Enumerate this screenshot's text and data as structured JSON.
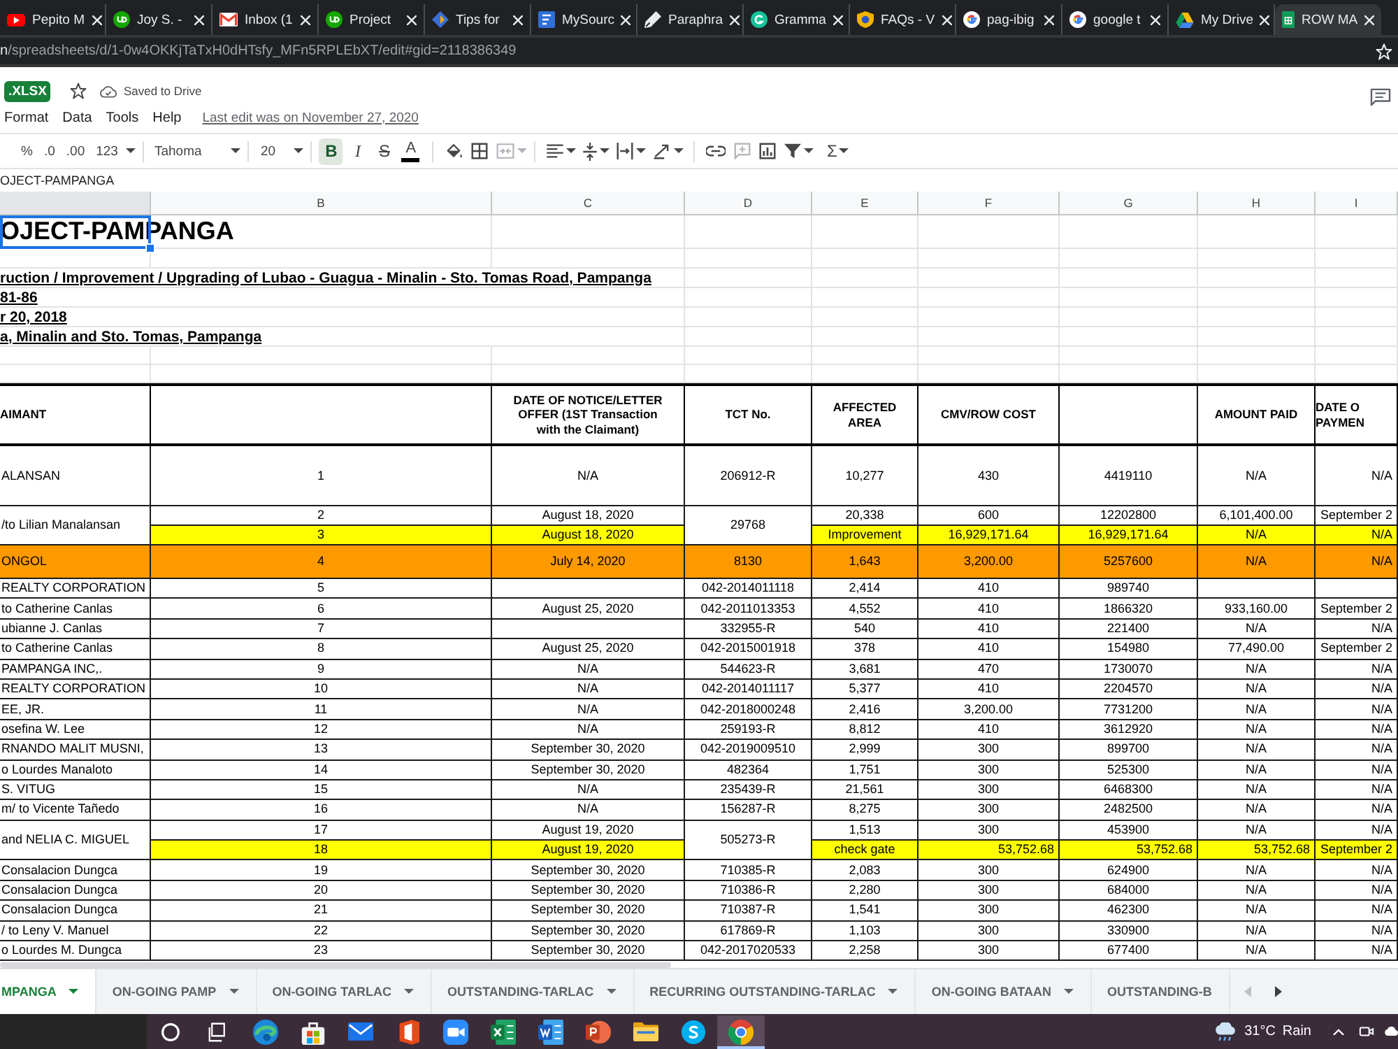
{
  "browser": {
    "tabs": [
      {
        "title": "Pepito M",
        "kind": "play",
        "selected": false
      },
      {
        "title": "Joy S. -",
        "kind": "badge",
        "selected": false
      },
      {
        "title": "Inbox (1",
        "kind": "mail",
        "selected": false
      },
      {
        "title": "Project",
        "kind": "badge",
        "selected": false
      },
      {
        "title": "Tips for",
        "kind": "diamond",
        "selected": false
      },
      {
        "title": "MySourc",
        "kind": "page",
        "selected": false
      },
      {
        "title": "Paraphra",
        "kind": "pen",
        "selected": false
      },
      {
        "title": "Gramma",
        "kind": "ring",
        "selected": false
      },
      {
        "title": "FAQs - V",
        "kind": "shield",
        "selected": false
      },
      {
        "title": "pag-ibig",
        "kind": "google",
        "selected": false
      },
      {
        "title": "google t",
        "kind": "google",
        "selected": false
      },
      {
        "title": "My Drive",
        "kind": "drive",
        "selected": false
      },
      {
        "title": "ROW MA",
        "kind": "sheet",
        "selected": true
      }
    ],
    "address": {
      "host": "n",
      "path": "/spreadsheets/d/1-0w4OKKjTaTxH0dHTsfy_MFn5RPLEbXT/edit#gid=2118386349"
    }
  },
  "document": {
    "file_type": ".XLSX",
    "save_status": "Saved to Drive",
    "menu": [
      "Format",
      "Data",
      "Tools",
      "Help"
    ],
    "last_edit": "Last edit was on November 27, 2020"
  },
  "toolbar": {
    "number_formats": [
      "%",
      ".0",
      ".00",
      "123"
    ],
    "font": "Tahoma",
    "font_size": "20",
    "format_buttons": [
      {
        "label": "B",
        "kind": "bold",
        "selected": true
      },
      {
        "label": "I",
        "kind": "italic",
        "selected": false
      },
      {
        "label": "S",
        "kind": "strike",
        "selected": false
      },
      {
        "label": "A",
        "kind": "color",
        "selected": false
      }
    ],
    "functions": "Σ"
  },
  "formula_bar": {
    "value": "OJECT-PAMPANGA"
  },
  "sheet": {
    "column_letters": [
      "B",
      "C",
      "D",
      "E",
      "F",
      "G",
      "H",
      "I"
    ],
    "title": "OJECT-PAMPANGA",
    "info_lines": [
      "ruction / Improvement / Upgrading of Lubao - Guagua - Minalin - Sto. Tomas Road, Pampanga",
      "81-86",
      "r 20, 2018",
      "a, Minalin and Sto. Tomas, Pampanga"
    ],
    "table": {
      "columns": [
        {
          "label": "AIMANT"
        },
        {},
        {
          "label": "DATE OF NOTICE/LETTER OFFER (1ST Transaction with the Claimant)"
        },
        {
          "label": "TCT No."
        },
        {
          "label": "AFFECTED AREA"
        },
        {
          "label": "CMV/ROW COST"
        },
        {},
        {
          "label": "AMOUNT PAID"
        },
        {
          "label": "DATE O PAYMEN"
        }
      ],
      "entries": [
        {
          "column_1": "ALANSAN",
          "tct_no": "206912-R",
          "lines": [
            {
              "kind": "standard",
              "column_2": "1",
              "notice_date": "N/A",
              "affected_area": "10,277",
              "cmv_row_cost": "430",
              "column_7": "4419110",
              "amount_paid": "N/A",
              "column_9": "N/A"
            }
          ]
        },
        {
          "column_1": "/to Lilian Manalansan",
          "tct_no": "29768",
          "lines": [
            {
              "kind": "standard",
              "column_2": "2",
              "notice_date": "August 18, 2020",
              "affected_area": "20,338",
              "cmv_row_cost": "600",
              "column_7": "12202800",
              "amount_paid": "6,101,400.00",
              "column_9": "September 2"
            },
            {
              "kind": "standard",
              "color": "#ffff00",
              "column_2": "3",
              "notice_date": "August 18, 2020",
              "affected_area": "Improvement",
              "cmv_row_cost": "16,929,171.64",
              "column_7": "16,929,171.64",
              "amount_paid": "N/A",
              "column_9": "N/A"
            }
          ]
        },
        {
          "column_1": "ONGOL",
          "tct_no": "8130",
          "color": "#ff9900",
          "lines": [
            {
              "kind": "standard",
              "column_2": "4",
              "notice_date": "July 14, 2020",
              "affected_area": "1,643",
              "cmv_row_cost": "3,200.00",
              "column_7": "5257600",
              "amount_paid": "N/A",
              "column_9": "N/A"
            }
          ]
        },
        {
          "column_1": "REALTY CORPORATION",
          "tct_no": "042-2014011118",
          "lines": [
            {
              "kind": "standard",
              "column_2": "5",
              "affected_area": "2,414",
              "cmv_row_cost": "410",
              "column_7": "989740"
            }
          ]
        },
        {
          "column_1": "to Catherine Canlas",
          "tct_no": "042-2011013353",
          "lines": [
            {
              "kind": "standard",
              "column_2": "6",
              "notice_date": "August 25, 2020",
              "affected_area": "4,552",
              "cmv_row_cost": "410",
              "column_7": "1866320",
              "amount_paid": "933,160.00",
              "column_9": "September 2"
            }
          ]
        },
        {
          "column_1": "ubianne J. Canlas",
          "tct_no": "332955-R",
          "lines": [
            {
              "kind": "standard",
              "column_2": "7",
              "affected_area": "540",
              "cmv_row_cost": "410",
              "column_7": "221400",
              "amount_paid": "N/A",
              "column_9": "N/A"
            }
          ]
        },
        {
          "column_1": "to Catherine Canlas",
          "tct_no": "042-2015001918",
          "lines": [
            {
              "kind": "standard",
              "column_2": "8",
              "notice_date": "August 25, 2020",
              "affected_area": "378",
              "cmv_row_cost": "410",
              "column_7": "154980",
              "amount_paid": "77,490.00",
              "column_9": "September 2"
            }
          ]
        },
        {
          "column_1": "PAMPANGA INC,.",
          "tct_no": "544623-R",
          "lines": [
            {
              "kind": "standard",
              "column_2": "9",
              "notice_date": "N/A",
              "affected_area": "3,681",
              "cmv_row_cost": "470",
              "column_7": "1730070",
              "amount_paid": "N/A",
              "column_9": "N/A"
            }
          ]
        },
        {
          "column_1": "REALTY CORPORATION",
          "tct_no": "042-2014011117",
          "lines": [
            {
              "kind": "standard",
              "column_2": "10",
              "notice_date": "N/A",
              "affected_area": "5,377",
              "cmv_row_cost": "410",
              "column_7": "2204570",
              "amount_paid": "N/A",
              "column_9": "N/A"
            }
          ]
        },
        {
          "column_1": "EE, JR.",
          "tct_no": "042-2018000248",
          "lines": [
            {
              "kind": "standard",
              "column_2": "11",
              "notice_date": "N/A",
              "affected_area": "2,416",
              "cmv_row_cost": "3,200.00",
              "column_7": "7731200",
              "amount_paid": "N/A",
              "column_9": "N/A"
            }
          ]
        },
        {
          "column_1": "osefina W. Lee",
          "tct_no": "259193-R",
          "lines": [
            {
              "kind": "standard",
              "column_2": "12",
              "notice_date": "N/A",
              "affected_area": "8,812",
              "cmv_row_cost": "410",
              "column_7": "3612920",
              "amount_paid": "N/A",
              "column_9": "N/A"
            }
          ]
        },
        {
          "column_1": "RNANDO MALIT MUSNI,",
          "tct_no": "042-2019009510",
          "lines": [
            {
              "kind": "standard",
              "column_2": "13",
              "notice_date": "September 30, 2020",
              "affected_area": "2,999",
              "cmv_row_cost": "300",
              "column_7": "899700",
              "amount_paid": "N/A",
              "column_9": "N/A"
            }
          ]
        },
        {
          "column_1": "o Lourdes Manaloto",
          "tct_no": "482364",
          "lines": [
            {
              "kind": "standard",
              "column_2": "14",
              "notice_date": "September 30, 2020",
              "affected_area": "1,751",
              "cmv_row_cost": "300",
              "column_7": "525300",
              "amount_paid": "N/A",
              "column_9": "N/A"
            }
          ]
        },
        {
          "column_1": "S. VITUG",
          "tct_no": "235439-R",
          "lines": [
            {
              "kind": "standard",
              "column_2": "15",
              "notice_date": "N/A",
              "affected_area": "21,561",
              "cmv_row_cost": "300",
              "column_7": "6468300",
              "amount_paid": "N/A",
              "column_9": "N/A"
            }
          ]
        },
        {
          "column_1": "m/ to Vicente Tañedo",
          "tct_no": "156287-R",
          "lines": [
            {
              "kind": "standard",
              "column_2": "16",
              "notice_date": "N/A",
              "affected_area": "8,275",
              "cmv_row_cost": "300",
              "column_7": "2482500",
              "amount_paid": "N/A",
              "column_9": "N/A"
            }
          ]
        },
        {
          "column_1": "and NELIA C. MIGUEL",
          "tct_no": "505273-R",
          "lines": [
            {
              "kind": "standard",
              "column_2": "17",
              "notice_date": "August 19, 2020",
              "affected_area": "1,513",
              "cmv_row_cost": "300",
              "column_7": "453900",
              "amount_paid": "N/A",
              "column_9": "N/A"
            },
            {
              "kind": "numeric",
              "color": "#ffff00",
              "column_2": "18",
              "notice_date": "August 19, 2020",
              "affected_area": "check gate",
              "cmv_row_cost": "53,752.68",
              "column_7": "53,752.68",
              "amount_paid": "53,752.68",
              "column_9": "September 2"
            }
          ]
        },
        {
          "column_1": "Consalacion Dungca",
          "tct_no": "710385-R",
          "lines": [
            {
              "kind": "standard",
              "column_2": "19",
              "notice_date": "September 30, 2020",
              "affected_area": "2,083",
              "cmv_row_cost": "300",
              "column_7": "624900",
              "amount_paid": "N/A",
              "column_9": "N/A"
            }
          ]
        },
        {
          "column_1": "Consalacion Dungca",
          "tct_no": "710386-R",
          "lines": [
            {
              "kind": "standard",
              "column_2": "20",
              "notice_date": "September 30, 2020",
              "affected_area": "2,280",
              "cmv_row_cost": "300",
              "column_7": "684000",
              "amount_paid": "N/A",
              "column_9": "N/A"
            }
          ]
        },
        {
          "column_1": "Consalacion Dungca",
          "tct_no": "710387-R",
          "lines": [
            {
              "kind": "standard",
              "column_2": "21",
              "notice_date": "September 30, 2020",
              "affected_area": "1,541",
              "cmv_row_cost": "300",
              "column_7": "462300",
              "amount_paid": "N/A",
              "column_9": "N/A"
            }
          ]
        },
        {
          "column_1": "/ to Leny V. Manuel",
          "tct_no": "617869-R",
          "lines": [
            {
              "kind": "standard",
              "column_2": "22",
              "notice_date": "September 30, 2020",
              "affected_area": "1,103",
              "cmv_row_cost": "300",
              "column_7": "330900",
              "amount_paid": "N/A",
              "column_9": "N/A"
            }
          ]
        },
        {
          "column_1": "o Lourdes M. Dungca",
          "tct_no": "042-2017020533",
          "lines": [
            {
              "kind": "standard",
              "column_2": "23",
              "notice_date": "September 30, 2020",
              "affected_area": "2,258",
              "cmv_row_cost": "300",
              "column_7": "677400",
              "amount_paid": "N/A",
              "column_9": "N/A"
            }
          ]
        }
      ]
    }
  },
  "sheet_tabs": [
    {
      "label": "MPANGA",
      "selected": true
    },
    {
      "label": "ON-GOING PAMP",
      "selected": false
    },
    {
      "label": "ON-GOING TARLAC",
      "selected": false
    },
    {
      "label": "OUTSTANDING-TARLAC",
      "selected": false
    },
    {
      "label": "RECURRING OUTSTANDING-TARLAC",
      "selected": false
    },
    {
      "label": "ON-GOING BATAAN",
      "selected": false
    },
    {
      "label": "OUTSTANDING-B",
      "selected": false
    }
  ],
  "taskbar": {
    "apps": [
      {
        "kind": "search",
        "selected": false
      },
      {
        "kind": "taskview",
        "selected": false
      },
      {
        "kind": "swirl",
        "selected": false
      },
      {
        "kind": "bag",
        "selected": false
      },
      {
        "kind": "mail",
        "selected": false
      },
      {
        "kind": "office",
        "selected": false
      },
      {
        "kind": "camera",
        "selected": false
      },
      {
        "kind": "sheet",
        "selected": false
      },
      {
        "kind": "doc",
        "selected": false
      },
      {
        "kind": "slides",
        "selected": false
      },
      {
        "kind": "folder",
        "selected": false
      },
      {
        "kind": "chat",
        "selected": false
      },
      {
        "kind": "browser",
        "selected": true
      }
    ],
    "weather": {
      "temperature": "31°C",
      "condition": "Rain"
    }
  }
}
